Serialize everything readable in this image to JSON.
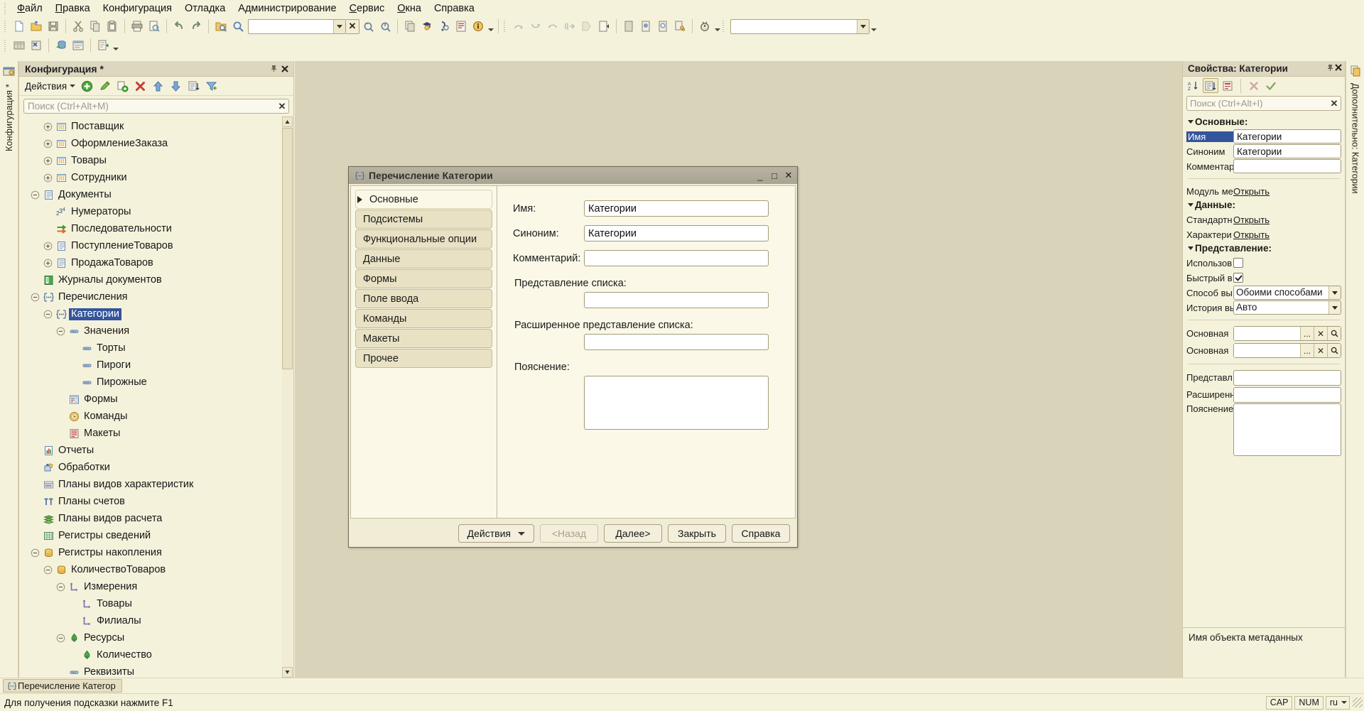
{
  "menubar": {
    "items": [
      {
        "label": "Файл",
        "accel": "Ф"
      },
      {
        "label": "Правка",
        "accel": "П"
      },
      {
        "label": "Конфигурация",
        "accel": ""
      },
      {
        "label": "Отладка",
        "accel": ""
      },
      {
        "label": "Администрирование",
        "accel": ""
      },
      {
        "label": "Сервис",
        "accel": "С"
      },
      {
        "label": "Окна",
        "accel": "О"
      },
      {
        "label": "Справка",
        "accel": ""
      }
    ]
  },
  "toolbar_main": {
    "combo1_value": "",
    "combo2_value": "",
    "icons": [
      "new-document-icon",
      "open-folder-icon",
      "save-icon",
      "cut-icon",
      "copy-icon",
      "paste-icon",
      "print-icon",
      "print-preview-icon",
      "undo-icon",
      "redo-icon",
      "find-in-folder-icon",
      "search-icon"
    ],
    "icons_after_combo": [
      "zoom-back-icon",
      "zoom-forward-icon",
      "copy-window-icon",
      "syntax-assistant-icon",
      "syntax-check-icon",
      "template-icon",
      "info-icon"
    ],
    "debug_icons": [
      "step-over-icon",
      "step-into-icon",
      "step-out-icon",
      "goto-cursor-icon",
      "run-to-icon",
      "next-statement-icon",
      "breakpoint-list-icon",
      "toggle-breakpoint-icon",
      "disable-breakpoint-icon",
      "remove-breakpoints-icon",
      "stop-debug-icon"
    ],
    "row2_icons": [
      "table-icon",
      "table-close-icon",
      "db-update-icon",
      "window-icon",
      "report-run-icon"
    ]
  },
  "left_vtab": {
    "label": "Конфигурация *",
    "icon": "configuration-icon"
  },
  "config_panel": {
    "title": "Конфигурация *",
    "pin_icon": "pin-icon",
    "close_icon": "close-icon",
    "actions_label": "Действия",
    "toolbar_icons": [
      "add-icon",
      "edit-icon",
      "copy-add-icon",
      "delete-icon",
      "move-up-icon",
      "move-down-icon",
      "sort-icon",
      "filter-icon"
    ],
    "search_placeholder": "Поиск (Ctrl+Alt+M)",
    "search_value": "",
    "tree": [
      {
        "label": "Поставщик",
        "indent": 2,
        "expander": "plus",
        "icon": "catalog-icon",
        "selected": false
      },
      {
        "label": "ОформлениеЗаказа",
        "indent": 2,
        "expander": "plus",
        "icon": "catalog-icon",
        "selected": false
      },
      {
        "label": "Товары",
        "indent": 2,
        "expander": "plus",
        "icon": "catalog-icon",
        "selected": false
      },
      {
        "label": "Сотрудники",
        "indent": 2,
        "expander": "plus",
        "icon": "catalog-icon",
        "selected": false
      },
      {
        "label": "Документы",
        "indent": 1,
        "expander": "minus",
        "icon": "document-icon",
        "selected": false
      },
      {
        "label": "Нумераторы",
        "indent": 2,
        "expander": "none",
        "icon": "numerator-icon",
        "selected": false
      },
      {
        "label": "Последовательности",
        "indent": 2,
        "expander": "none",
        "icon": "sequence-icon",
        "selected": false
      },
      {
        "label": "ПоступлениеТоваров",
        "indent": 2,
        "expander": "plus",
        "icon": "document-icon",
        "selected": false
      },
      {
        "label": "ПродажаТоваров",
        "indent": 2,
        "expander": "plus",
        "icon": "document-icon",
        "selected": false
      },
      {
        "label": "Журналы документов",
        "indent": 1,
        "expander": "none",
        "icon": "journal-icon",
        "selected": false
      },
      {
        "label": "Перечисления",
        "indent": 1,
        "expander": "minus",
        "icon": "enum-icon",
        "selected": false
      },
      {
        "label": "Категории",
        "indent": 2,
        "expander": "minus",
        "icon": "enum-icon",
        "selected": true
      },
      {
        "label": "Значения",
        "indent": 3,
        "expander": "minus",
        "icon": "enum-value-icon",
        "selected": false
      },
      {
        "label": "Торты",
        "indent": 4,
        "expander": "none",
        "icon": "enum-value-icon",
        "selected": false
      },
      {
        "label": "Пироги",
        "indent": 4,
        "expander": "none",
        "icon": "enum-value-icon",
        "selected": false
      },
      {
        "label": "Пирожные",
        "indent": 4,
        "expander": "none",
        "icon": "enum-value-icon",
        "selected": false
      },
      {
        "label": "Формы",
        "indent": 3,
        "expander": "none",
        "icon": "form-icon",
        "selected": false
      },
      {
        "label": "Команды",
        "indent": 3,
        "expander": "none",
        "icon": "command-icon",
        "selected": false
      },
      {
        "label": "Макеты",
        "indent": 3,
        "expander": "none",
        "icon": "template-icon",
        "selected": false
      },
      {
        "label": "Отчеты",
        "indent": 1,
        "expander": "none",
        "icon": "report-icon",
        "selected": false
      },
      {
        "label": "Обработки",
        "indent": 1,
        "expander": "none",
        "icon": "dataprocessor-icon",
        "selected": false
      },
      {
        "label": "Планы видов характеристик",
        "indent": 1,
        "expander": "none",
        "icon": "chart-of-characteristic-types-icon",
        "selected": false
      },
      {
        "label": "Планы счетов",
        "indent": 1,
        "expander": "none",
        "icon": "chart-of-accounts-icon",
        "selected": false
      },
      {
        "label": "Планы видов расчета",
        "indent": 1,
        "expander": "none",
        "icon": "chart-of-calculation-types-icon",
        "selected": false
      },
      {
        "label": "Регистры сведений",
        "indent": 1,
        "expander": "none",
        "icon": "information-register-icon",
        "selected": false
      },
      {
        "label": "Регистры накопления",
        "indent": 1,
        "expander": "minus",
        "icon": "accumulation-register-icon",
        "selected": false
      },
      {
        "label": "КоличествоТоваров",
        "indent": 2,
        "expander": "minus",
        "icon": "accumulation-register-icon",
        "selected": false
      },
      {
        "label": "Измерения",
        "indent": 3,
        "expander": "minus",
        "icon": "dimension-icon",
        "selected": false
      },
      {
        "label": "Товары",
        "indent": 4,
        "expander": "none",
        "icon": "dimension-icon",
        "selected": false
      },
      {
        "label": "Филиалы",
        "indent": 4,
        "expander": "none",
        "icon": "dimension-icon",
        "selected": false
      },
      {
        "label": "Ресурсы",
        "indent": 3,
        "expander": "minus",
        "icon": "resource-icon",
        "selected": false
      },
      {
        "label": "Количество",
        "indent": 4,
        "expander": "none",
        "icon": "resource-icon",
        "selected": false
      },
      {
        "label": "Реквизиты",
        "indent": 3,
        "expander": "none",
        "icon": "attribute-icon",
        "selected": false
      }
    ]
  },
  "dialog": {
    "title": "Перечисление Категории",
    "title_icon": "enum-icon",
    "minimize_label": "_",
    "maximize_label": "□",
    "close_label": "✕",
    "nav_items": [
      {
        "label": "Основные",
        "active": true
      },
      {
        "label": "Подсистемы",
        "active": false
      },
      {
        "label": "Функциональные опции",
        "active": false
      },
      {
        "label": "Данные",
        "active": false
      },
      {
        "label": "Формы",
        "active": false
      },
      {
        "label": "Поле ввода",
        "active": false
      },
      {
        "label": "Команды",
        "active": false
      },
      {
        "label": "Макеты",
        "active": false
      },
      {
        "label": "Прочее",
        "active": false
      }
    ],
    "fields": {
      "name_label": "Имя:",
      "name_value": "Категории",
      "synonym_label": "Синоним:",
      "synonym_value": "Категории",
      "comment_label": "Комментарий:",
      "comment_value": "",
      "list_presentation_label": "Представление списка:",
      "list_presentation_value": "",
      "extended_list_presentation_label": "Расширенное представление списка:",
      "extended_list_presentation_value": "",
      "explanation_label": "Пояснение:",
      "explanation_value": ""
    },
    "buttons": {
      "actions": "Действия",
      "back": "<Назад",
      "next": "Далее>",
      "close": "Закрыть",
      "help": "Справка"
    }
  },
  "properties": {
    "title": "Свойства: Категории",
    "pin_icon": "pin-icon",
    "close_icon": "close-icon",
    "toolbar_icons": [
      "sort-az-icon",
      "sort-by-category-icon",
      "show-all-icon",
      "clear-icon",
      "apply-icon"
    ],
    "search_placeholder": "Поиск (Ctrl+Alt+I)",
    "search_value": "",
    "groups": [
      {
        "title": "Основные:",
        "rows": [
          {
            "label": "Имя",
            "type": "text",
            "value": "Категории",
            "label_selected": true
          },
          {
            "label": "Синоним",
            "type": "text",
            "value": "Категории",
            "label_selected": false
          },
          {
            "label": "Комментар",
            "type": "text",
            "value": "",
            "label_selected": false
          }
        ]
      }
    ],
    "module_label": "Модуль ме",
    "module_link": "Открыть",
    "data_group_title": "Данные:",
    "standard_label": "Стандартн",
    "standard_link": "Открыть",
    "characteristics_label": "Характери",
    "characteristics_link": "Открыть",
    "presentation_group_title": "Представление:",
    "use_standard_label": "Использов",
    "use_standard_checked": false,
    "quick_choice_label": "Быстрый в",
    "quick_choice_checked": true,
    "choice_mode_label": "Способ вы",
    "choice_mode_value": "Обоими способами",
    "history_label": "История вы",
    "history_value": "Авто",
    "main_form1_label": "Основная ",
    "main_form1_value": "",
    "main_form2_label": "Основная ",
    "main_form2_value": "",
    "presentation_label": "Представл",
    "presentation_value": "",
    "extended_label": "Расширенн",
    "extended_value": "",
    "explanation_label": "Пояснение",
    "explanation_value": "",
    "select_btn_dots": "...",
    "select_btn_clear": "✕",
    "select_btn_open": "search-icon",
    "description": "Имя объекта метаданных"
  },
  "right_vtab": {
    "label": "Дополнительно: Категории",
    "icon": "additional-icon"
  },
  "taskbar": {
    "items": [
      {
        "label": "Перечисление Категор",
        "icon": "enum-icon"
      }
    ]
  },
  "statusbar": {
    "message": "Для получения подсказки нажмите F1",
    "cap": "CAP",
    "num": "NUM",
    "lang": "ru"
  },
  "colors": {
    "window_bg": "#f5f2dc",
    "mdi_bg": "#d8d3b9",
    "selection": "#33559b",
    "title_bar": "#ddd7c0",
    "dialog_title": "#b0ab99"
  }
}
